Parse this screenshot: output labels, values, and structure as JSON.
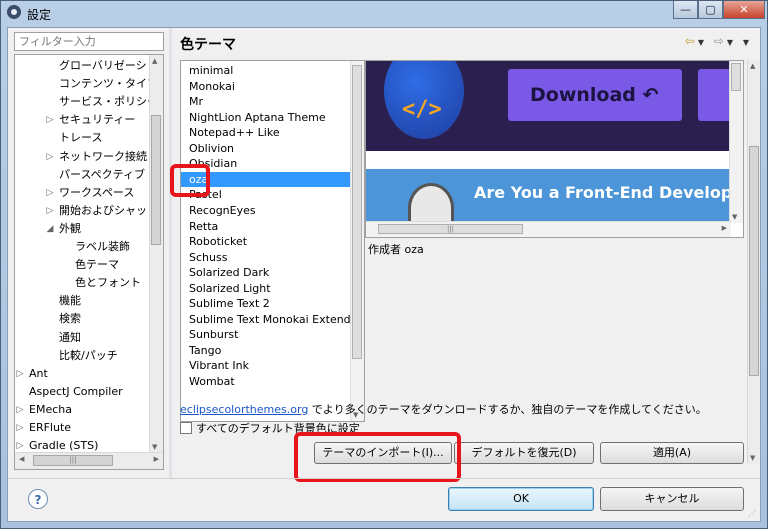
{
  "window": {
    "title": "設定",
    "buttons": {
      "minimize": "—",
      "maximize": "▢",
      "close": "✕"
    }
  },
  "filter": {
    "placeholder": "フィルター入力"
  },
  "tree": {
    "items": [
      {
        "label": "グローバリゼーショ",
        "indent": 2,
        "arrow": ""
      },
      {
        "label": "コンテンツ・タイプ",
        "indent": 2,
        "arrow": ""
      },
      {
        "label": "サービス・ポリシー",
        "indent": 2,
        "arrow": ""
      },
      {
        "label": "セキュリティー",
        "indent": 2,
        "arrow": "▷"
      },
      {
        "label": "トレース",
        "indent": 2,
        "arrow": ""
      },
      {
        "label": "ネットワーク接続",
        "indent": 2,
        "arrow": "▷"
      },
      {
        "label": "パースペクティブ",
        "indent": 2,
        "arrow": ""
      },
      {
        "label": "ワークスペース",
        "indent": 2,
        "arrow": "▷"
      },
      {
        "label": "開始およびシャット",
        "indent": 2,
        "arrow": "▷"
      },
      {
        "label": "外観",
        "indent": 2,
        "arrow": "◢"
      },
      {
        "label": "ラベル装飾",
        "indent": 3,
        "arrow": ""
      },
      {
        "label": "色テーマ",
        "indent": 3,
        "arrow": ""
      },
      {
        "label": "色とフォント",
        "indent": 3,
        "arrow": ""
      },
      {
        "label": "機能",
        "indent": 2,
        "arrow": ""
      },
      {
        "label": "検索",
        "indent": 2,
        "arrow": ""
      },
      {
        "label": "通知",
        "indent": 2,
        "arrow": ""
      },
      {
        "label": "比較/パッチ",
        "indent": 2,
        "arrow": ""
      },
      {
        "label": "Ant",
        "indent": 0,
        "arrow": "▷"
      },
      {
        "label": "AspectJ Compiler",
        "indent": 0,
        "arrow": ""
      },
      {
        "label": "EMecha",
        "indent": 0,
        "arrow": "▷"
      },
      {
        "label": "ERFlute",
        "indent": 0,
        "arrow": "▷"
      },
      {
        "label": "Gradle (STS)",
        "indent": 0,
        "arrow": "▷"
      }
    ]
  },
  "page": {
    "title": "色テーマ"
  },
  "themes": {
    "selected_index": 7,
    "items": [
      "minimal",
      "Monokai",
      "Mr",
      "NightLion Aptana Theme",
      "Notepad++ Like",
      "Oblivion",
      "Obsidian",
      "oza",
      "Pastel",
      "RecognEyes",
      "Retta",
      "Roboticket",
      "Schuss",
      "Solarized Dark",
      "Solarized Light",
      "Sublime Text 2",
      "Sublime Text Monokai Extended",
      "Sunburst",
      "Tango",
      "Vibrant Ink",
      "Wombat"
    ]
  },
  "preview": {
    "download_label": "Download",
    "banner_text": "Are You a Front-End Developer?",
    "code_glyph": "</>",
    "author": "作成者 oza"
  },
  "info": {
    "link": "eclipsecolorthemes.org",
    "text": " でより多くのテーマをダウンロードするか、独自のテーマを作成してください。"
  },
  "checkbox": {
    "label": "すべてのデフォルト背景色に設定",
    "checked": false
  },
  "buttons": {
    "import": "テーマのインポート(I)...",
    "restore_defaults": "デフォルトを復元(D)",
    "apply": "適用(A)",
    "ok": "OK",
    "cancel": "キャンセル"
  },
  "help": {
    "symbol": "?"
  },
  "colors": {
    "selection": "#3399ff",
    "highlight": "#e8141b",
    "link": "#1a56c9"
  }
}
